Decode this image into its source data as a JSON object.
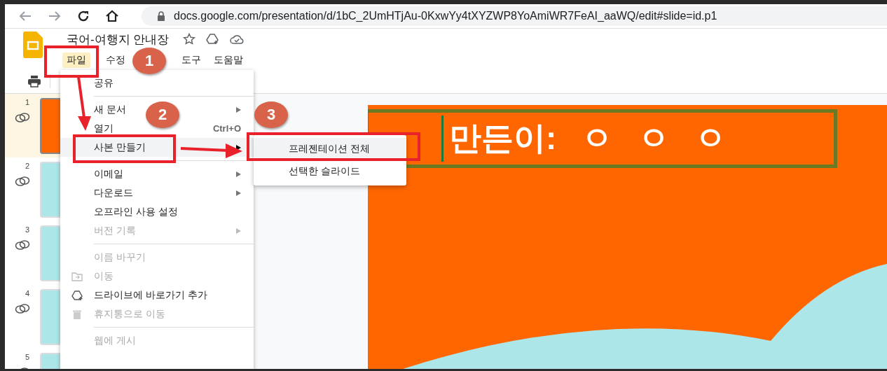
{
  "browser": {
    "url": "docs.google.com/presentation/d/1bC_2UmHTjAu-0KxwYy4tXYZWP8YoAmiWR7FeAI_aaWQ/edit#slide=id.p1"
  },
  "doc": {
    "title": "국어-여행지 안내장"
  },
  "menubar": [
    {
      "label": "파일",
      "selected": true
    },
    {
      "label": "수정",
      "selected": false
    },
    {
      "label": "도구",
      "selected": false
    },
    {
      "label": "도움말",
      "selected": false
    }
  ],
  "slides": [
    {
      "number": "1",
      "selected": true
    },
    {
      "number": "2",
      "selected": false
    },
    {
      "number": "3",
      "selected": false
    },
    {
      "number": "4",
      "selected": false
    },
    {
      "number": "5",
      "selected": false
    }
  ],
  "slide": {
    "text": "만든이: ㅇ ㅇ ㅇ"
  },
  "file_menu": [
    {
      "kind": "item",
      "label": "공유",
      "disabled": false,
      "selected": false
    },
    {
      "kind": "divider"
    },
    {
      "kind": "item",
      "label": "새 문서",
      "disabled": false,
      "submenu": true,
      "selected": false
    },
    {
      "kind": "item",
      "label": "열기",
      "shortcut": "Ctrl+O",
      "disabled": false,
      "selected": false
    },
    {
      "kind": "item",
      "label": "사본 만들기",
      "disabled": false,
      "submenu": true,
      "selected": true
    },
    {
      "kind": "divider"
    },
    {
      "kind": "item",
      "label": "이메일",
      "disabled": false,
      "submenu": true,
      "selected": false
    },
    {
      "kind": "item",
      "label": "다운로드",
      "disabled": false,
      "submenu": true,
      "selected": false
    },
    {
      "kind": "item",
      "label": "오프라인 사용 설정",
      "disabled": false,
      "selected": false
    },
    {
      "kind": "item",
      "label": "버전 기록",
      "disabled": true,
      "submenu": true,
      "selected": false
    },
    {
      "kind": "divider"
    },
    {
      "kind": "item",
      "label": "이름 바꾸기",
      "disabled": true,
      "selected": false
    },
    {
      "kind": "item",
      "label": "이동",
      "disabled": true,
      "selected": false
    },
    {
      "kind": "item",
      "label": "드라이브에 바로가기 추가",
      "disabled": false,
      "selected": false
    },
    {
      "kind": "item",
      "label": "휴지통으로 이동",
      "disabled": true,
      "selected": false
    },
    {
      "kind": "divider"
    },
    {
      "kind": "item",
      "label": "웹에 게시",
      "disabled": true,
      "selected": false
    }
  ],
  "copy_submenu": [
    {
      "label": "프레젠테이션 전체",
      "selected": true
    },
    {
      "label": "선택한 슬라이드",
      "selected": false
    }
  ],
  "annotations": [
    {
      "number": "1"
    },
    {
      "number": "2"
    },
    {
      "number": "3"
    }
  ]
}
